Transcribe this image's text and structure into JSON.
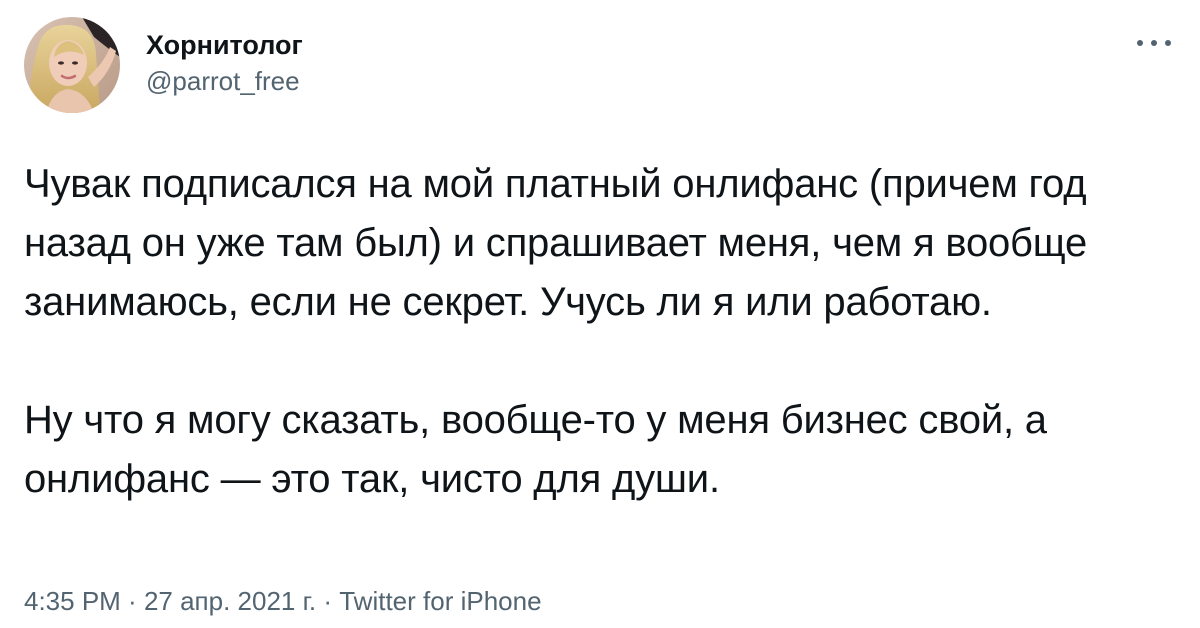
{
  "author": {
    "display_name": "Хорнитолог",
    "handle": "@parrot_free",
    "avatar_icon": "user-avatar-photo"
  },
  "more_icon": "ellipsis-icon",
  "tweet": {
    "paragraphs": [
      "Чувак подписался на мой платный онлифанс (причем год назад он уже там был) и спрашивает меня, чем я вообще занимаюсь, если не секрет. Учусь ли я или работаю.",
      "Ну что я могу сказать, вообще-то у меня бизнес свой, а онлифанс — это так, чисто для души."
    ]
  },
  "meta": {
    "time": "4:35 PM",
    "separator_1": " · ",
    "date": "27 апр. 2021 г.",
    "separator_2": " · ",
    "source": "Twitter for iPhone"
  },
  "colors": {
    "text_primary": "#0f1419",
    "text_secondary": "#536471",
    "background": "#ffffff"
  }
}
